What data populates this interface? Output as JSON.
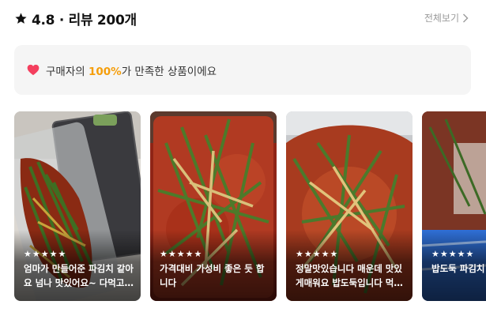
{
  "header": {
    "rating_text": "4.8 · 리뷰 200개",
    "see_all": "전체보기"
  },
  "satisfaction": {
    "prefix": "구매자의 ",
    "percent": "100%",
    "suffix": "가 만족한 상품이에요",
    "accent": "#f59e0b",
    "heart_color": "#f43f5e"
  },
  "reviews": [
    {
      "stars": "★★★★★",
      "text": "엄마가 만들어준 파김치 같아요 넘나 맛있어요~ 다먹고 ..."
    },
    {
      "stars": "★★★★★",
      "text": "가격대비 가성비 좋은 듯 합니다"
    },
    {
      "stars": "★★★★★",
      "text": "정말맛있습니다 매운데 맛있게매워요 밥도둑입니다 먹으..."
    },
    {
      "stars": "★★★★★",
      "text": "밥도둑 파김치 뚝딱~~~!!"
    }
  ]
}
